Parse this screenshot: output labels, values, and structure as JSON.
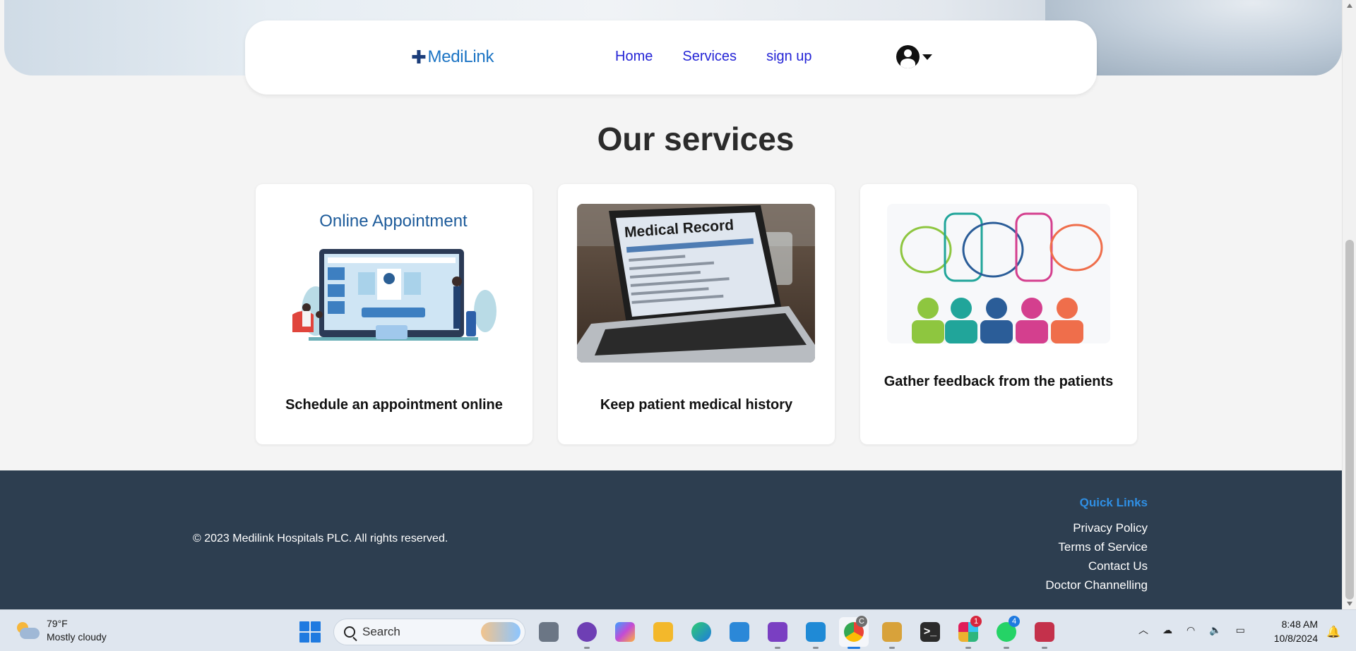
{
  "navbar": {
    "logo_text": "MediLink",
    "links": [
      "Home",
      "Services",
      "sign up"
    ]
  },
  "services": {
    "title": "Our services",
    "cards": [
      {
        "image_caption": "Online Appointment",
        "caption": "Schedule an appointment online"
      },
      {
        "image_caption": "Medical Record",
        "caption": "Keep patient medical history"
      },
      {
        "image_caption": "",
        "caption": "Gather feedback from the patients"
      }
    ]
  },
  "footer": {
    "copyright": "© 2023 Medilink Hospitals PLC. All rights reserved.",
    "quick_links_title": "Quick Links",
    "links": [
      "Privacy Policy",
      "Terms of Service",
      "Contact Us",
      "Doctor Channelling"
    ]
  },
  "taskbar": {
    "weather_temp": "79°F",
    "weather_desc": "Mostly cloudy",
    "search_placeholder": "Search",
    "time": "8:48 AM",
    "date": "10/8/2024",
    "badges": {
      "chrome": "C",
      "slack": "1",
      "whatsapp": "4"
    }
  },
  "colors": {
    "link": "#2525d6",
    "brand": "#1c74c4",
    "footer_bg": "#2d3e50",
    "quick_links_accent": "#2f8fe4"
  }
}
